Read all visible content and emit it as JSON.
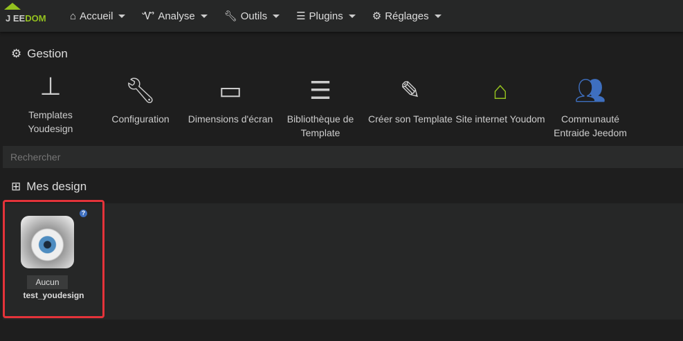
{
  "brand": {
    "prefix": "J",
    "e": "EE",
    "dom": "DOM"
  },
  "nav": [
    {
      "icon": "home-icon",
      "label": "Accueil"
    },
    {
      "icon": "stethoscope-icon",
      "label": "Analyse"
    },
    {
      "icon": "wrench-icon",
      "label": "Outils"
    },
    {
      "icon": "tasks-icon",
      "label": "Plugins"
    },
    {
      "icon": "gear-icon",
      "label": "Réglages"
    }
  ],
  "gestion": {
    "title": "Gestion",
    "tiles": [
      {
        "icon": "sitemap-icon",
        "label": "Templates Youdesign",
        "color": "#cccccc"
      },
      {
        "icon": "wrench-icon",
        "label": "Configuration",
        "color": "#cccccc"
      },
      {
        "icon": "desktop-icon",
        "label": "Dimensions d'écran",
        "color": "#cccccc"
      },
      {
        "icon": "list-icon",
        "label": "Bibliothèque de Template",
        "color": "#cccccc"
      },
      {
        "icon": "edit-icon",
        "label": "Créer son Template",
        "color": "#cccccc"
      },
      {
        "icon": "home-icon",
        "label": "Site internet Youdom",
        "color": "#94c11f"
      },
      {
        "icon": "users-icon",
        "label": "Communauté Entraide Jeedom",
        "color": "#3e6fbf"
      }
    ]
  },
  "search": {
    "placeholder": "Rechercher"
  },
  "mes_design": {
    "title": "Mes design",
    "items": [
      {
        "badge": "Aucun",
        "name": "test_youdesign",
        "help": "?"
      }
    ]
  }
}
